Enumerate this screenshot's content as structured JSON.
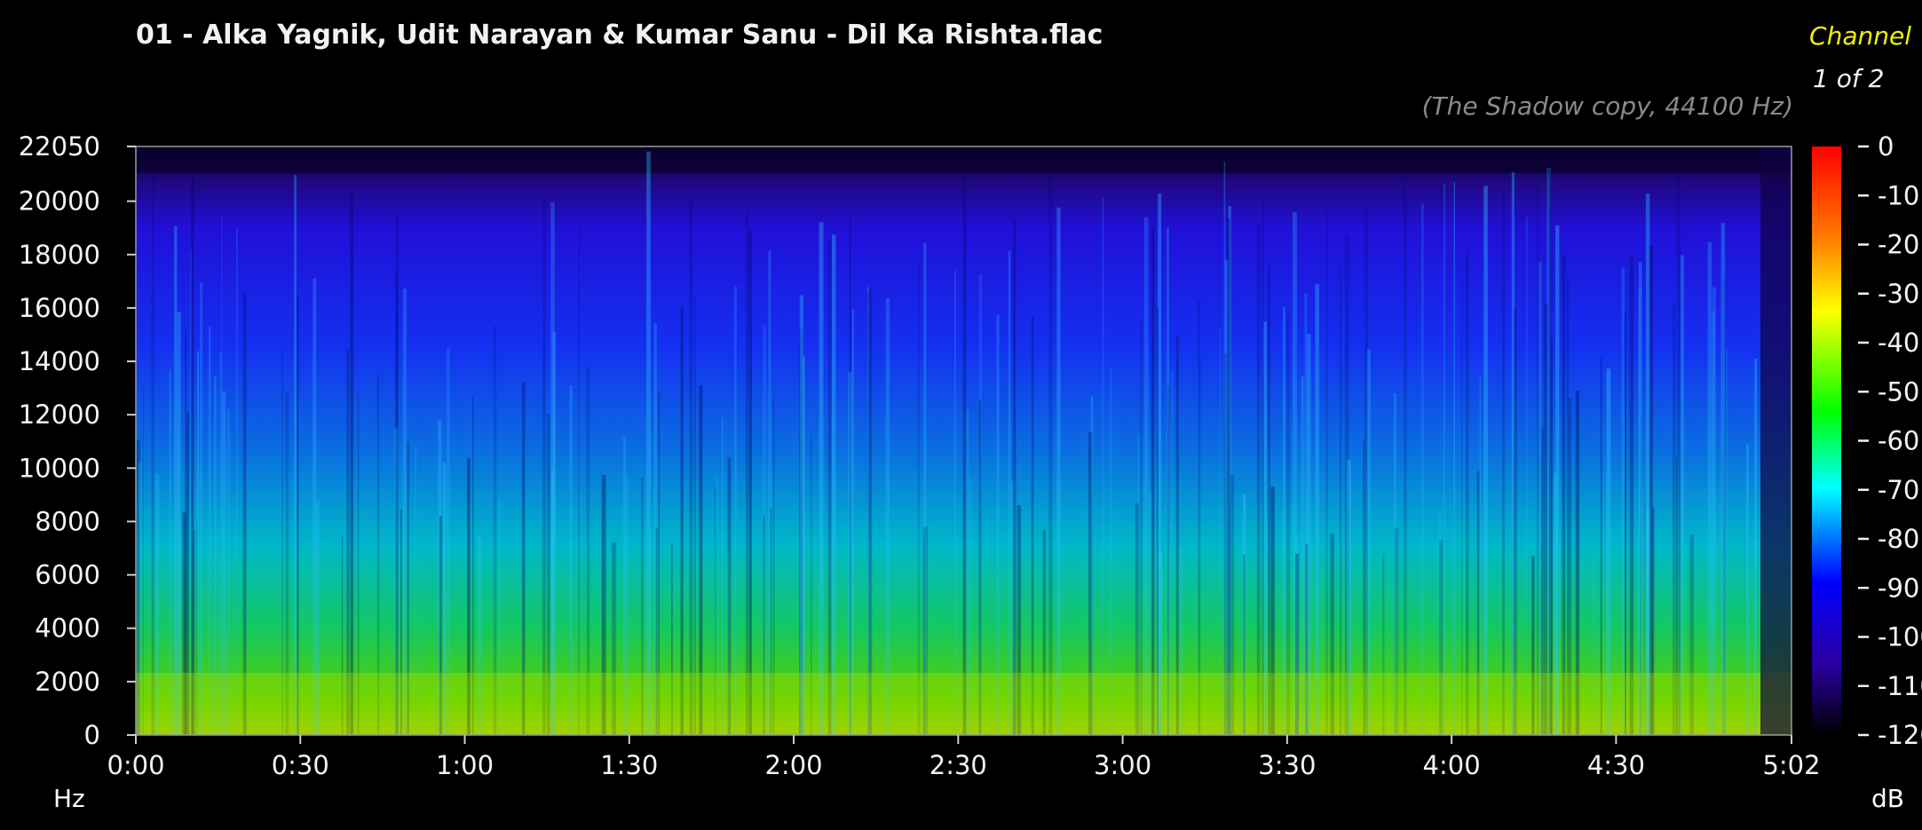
{
  "header": {
    "title": "01 - Alka Yagnik, Udit Narayan & Kumar Sanu - Dil Ka Rishta.flac",
    "subtitle": "(The Shadow copy, 44100 Hz)",
    "channel_label": "Channel",
    "channel_count": "1 of 2"
  },
  "units": {
    "y": "Hz",
    "colorbar": "dB"
  },
  "colors": {
    "title": "#f2f2f2",
    "channel_label": "#f2f200",
    "subtitle": "#8a8a8a",
    "background": "#000000"
  },
  "chart_data": {
    "type": "heatmap",
    "title": "01 - Alka Yagnik, Udit Narayan & Kumar Sanu - Dil Ka Rishta.flac",
    "subtitle": "(The Shadow copy, 44100 Hz)",
    "xlabel": "",
    "ylabel": "Hz",
    "x_ticks": [
      "0:00",
      "0:30",
      "1:00",
      "1:30",
      "2:00",
      "2:30",
      "3:00",
      "3:30",
      "4:00",
      "4:30",
      "5:02"
    ],
    "x_tick_seconds": [
      0,
      30,
      60,
      90,
      120,
      150,
      180,
      210,
      240,
      270,
      302
    ],
    "y_ticks": [
      22050,
      20000,
      18000,
      16000,
      14000,
      12000,
      10000,
      8000,
      6000,
      4000,
      2000,
      0
    ],
    "xlim": [
      0,
      302
    ],
    "ylim": [
      0,
      22050
    ],
    "colorbar": {
      "label": "dB",
      "range": [
        -120,
        0
      ],
      "ticks": [
        "0",
        "-10",
        "-20",
        "-30",
        "-40",
        "-50",
        "-60",
        "-70",
        "-80",
        "-90",
        "-100",
        "-110",
        "-120"
      ],
      "colormap": [
        "#ff0000",
        "#ff8000",
        "#ffff00",
        "#00ff00",
        "#00ffff",
        "#0000ff",
        "#2000a0",
        "#000000"
      ]
    },
    "grid": false
  }
}
